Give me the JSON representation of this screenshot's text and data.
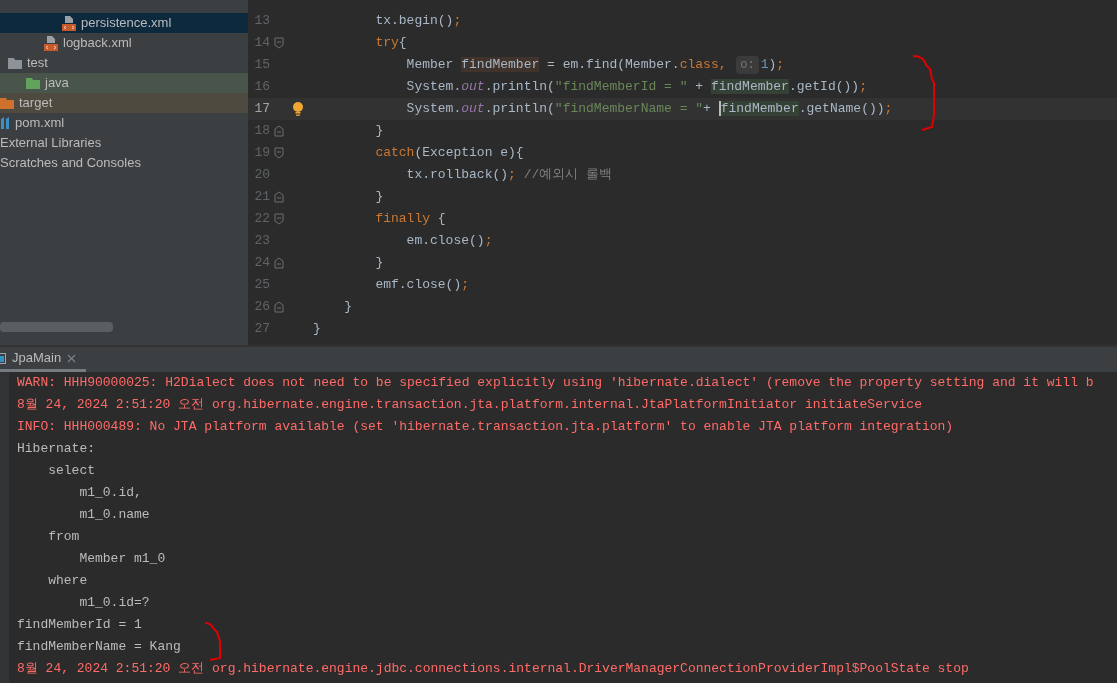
{
  "project_tree": [
    {
      "children": [
        {
          "children": [
            {
              "children": [
                {
                  "children": [
                    {
                      "label": "persistence.xml",
                      "kind": "xml",
                      "selected": true
                    }
                  ]
                },
                {
                  "label": "logback.xml",
                  "kind": "xml",
                  "selected": false
                }
              ]
            }
          ]
        },
        {
          "label": "test",
          "kind": "folder",
          "selected": false,
          "children": [
            {
              "label": "java",
              "kind": "test-folder",
              "selected": false
            }
          ]
        }
      ]
    },
    {
      "label": "target",
      "kind": "excluded-folder",
      "selected": false
    },
    {
      "label": "pom.xml",
      "kind": "maven",
      "selected": false
    },
    {
      "label": "External Libraries",
      "kind": "plain",
      "selected": false
    },
    {
      "label": "Scratches and Consoles",
      "kind": "plain",
      "selected": false
    }
  ],
  "editor": {
    "lines": [
      {
        "number": "13",
        "tokens": [
          {
            "text": "        tx.begin()",
            "kind": "plain"
          },
          {
            "text": ";",
            "kind": "punct"
          }
        ]
      },
      {
        "number": "14",
        "fold_start": true,
        "tokens": [
          {
            "text": "        try",
            "kind": "keyword"
          },
          {
            "text": "{",
            "kind": "plain"
          }
        ]
      },
      {
        "number": "15",
        "tokens": [
          {
            "text": "            Member ",
            "kind": "plain"
          },
          {
            "text": "findMember",
            "kind": "write-usage"
          },
          {
            "text": " = em.find(Member.",
            "kind": "plain"
          },
          {
            "text": "class",
            "kind": "keyword"
          },
          {
            "text": ", ",
            "kind": "punct"
          },
          {
            "text": "o:",
            "kind": "hint"
          },
          {
            "text": "1",
            "kind": "number"
          },
          {
            "text": ")",
            "kind": "plain"
          },
          {
            "text": ";",
            "kind": "punct"
          }
        ]
      },
      {
        "number": "16",
        "tokens": [
          {
            "text": "            System.",
            "kind": "plain"
          },
          {
            "text": "out",
            "kind": "static"
          },
          {
            "text": ".println(",
            "kind": "plain"
          },
          {
            "text": "\"findMemberId = \"",
            "kind": "string"
          },
          {
            "text": " + ",
            "kind": "plain"
          },
          {
            "text": "findMember",
            "kind": "read-usage"
          },
          {
            "text": ".getId())",
            "kind": "plain"
          },
          {
            "text": ";",
            "kind": "punct"
          }
        ]
      },
      {
        "number": "17",
        "current": true,
        "bulb": true,
        "tokens": [
          {
            "text": "            System.",
            "kind": "plain"
          },
          {
            "text": "out",
            "kind": "static"
          },
          {
            "text": ".println(",
            "kind": "plain"
          },
          {
            "text": "\"findMemberName = \"",
            "kind": "string"
          },
          {
            "text": "+ ",
            "kind": "plain"
          },
          {
            "text": "findMember",
            "kind": "read-usage",
            "caret": true
          },
          {
            "text": ".getName())",
            "kind": "plain"
          },
          {
            "text": ";",
            "kind": "punct"
          }
        ]
      },
      {
        "number": "18",
        "fold_end": true,
        "tokens": [
          {
            "text": "        }",
            "kind": "plain"
          }
        ]
      },
      {
        "number": "19",
        "fold_start": true,
        "tokens": [
          {
            "text": "        catch",
            "kind": "keyword"
          },
          {
            "text": "(Exception e){",
            "kind": "plain"
          }
        ]
      },
      {
        "number": "20",
        "tokens": [
          {
            "text": "            tx.rollback()",
            "kind": "plain"
          },
          {
            "text": ";",
            "kind": "punct"
          },
          {
            "text": " //예외시 롤백",
            "kind": "comment"
          }
        ]
      },
      {
        "number": "21",
        "fold_end": true,
        "tokens": [
          {
            "text": "        }",
            "kind": "plain"
          }
        ]
      },
      {
        "number": "22",
        "fold_start": true,
        "tokens": [
          {
            "text": "        finally",
            "kind": "keyword"
          },
          {
            "text": " {",
            "kind": "plain"
          }
        ]
      },
      {
        "number": "23",
        "tokens": [
          {
            "text": "            em.close()",
            "kind": "plain"
          },
          {
            "text": ";",
            "kind": "punct"
          }
        ]
      },
      {
        "number": "24",
        "fold_end": true,
        "tokens": [
          {
            "text": "        }",
            "kind": "plain"
          }
        ]
      },
      {
        "number": "25",
        "tokens": [
          {
            "text": "        emf.close()",
            "kind": "plain"
          },
          {
            "text": ";",
            "kind": "punct"
          }
        ]
      },
      {
        "number": "26",
        "fold_end": true,
        "tokens": [
          {
            "text": "    }",
            "kind": "plain"
          }
        ]
      },
      {
        "number": "27",
        "tokens": [
          {
            "text": "}",
            "kind": "plain"
          }
        ]
      }
    ]
  },
  "run_panel": {
    "tabs": [
      {
        "label": "JpaMain",
        "selected": true
      }
    ],
    "console": [
      {
        "kind": "error",
        "text": "WARN: HHH90000025: H2Dialect does not need to be specified explicitly using 'hibernate.dialect' (remove the property setting and it will b"
      },
      {
        "kind": "error",
        "text": "8월 24, 2024 2:51:20 오전 org.hibernate.engine.transaction.jta.platform.internal.JtaPlatformInitiator initiateService"
      },
      {
        "kind": "error",
        "text": "INFO: HHH000489: No JTA platform available (set 'hibernate.transaction.jta.platform' to enable JTA platform integration)"
      },
      {
        "kind": "output",
        "text": "Hibernate: "
      },
      {
        "kind": "output",
        "text": "    select"
      },
      {
        "kind": "output",
        "text": "        m1_0.id,"
      },
      {
        "kind": "output",
        "text": "        m1_0.name "
      },
      {
        "kind": "output",
        "text": "    from"
      },
      {
        "kind": "output",
        "text": "        Member m1_0 "
      },
      {
        "kind": "output",
        "text": "    where"
      },
      {
        "kind": "output",
        "text": "        m1_0.id=?"
      },
      {
        "kind": "output",
        "text": "findMemberId = 1"
      },
      {
        "kind": "output",
        "text": "findMemberName = Kang"
      },
      {
        "kind": "error",
        "text": "8월 24, 2024 2:51:20 오전 org.hibernate.engine.jdbc.connections.internal.DriverManagerConnectionProviderImpl$PoolState stop"
      }
    ]
  }
}
